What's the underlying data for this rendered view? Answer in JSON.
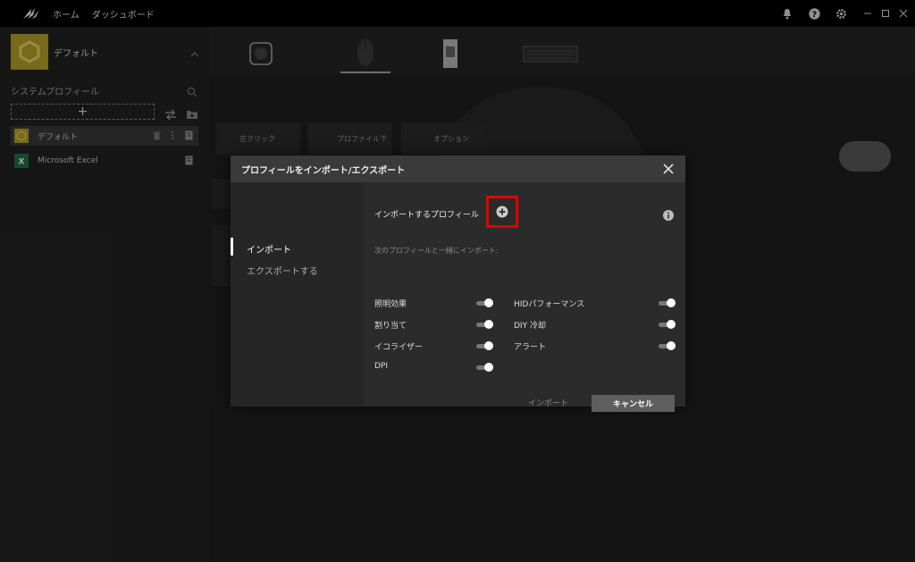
{
  "topbar": {
    "nav": [
      "ホーム",
      "ダッシュボード"
    ]
  },
  "sidebar": {
    "current_profile": "デフォルト",
    "section_label": "システムプロフィール",
    "add_symbol": "+",
    "profiles": [
      {
        "label": "デフォルト",
        "selected": true
      },
      {
        "label": "Microsoft Excel",
        "selected": false
      }
    ]
  },
  "main": {
    "ghost_buttons": [
      "左クリック",
      "プロファイル下",
      "オプション"
    ]
  },
  "dialog": {
    "title": "プロフィールをインポート/エクスポート",
    "tabs": [
      {
        "label": "インポート",
        "active": true
      },
      {
        "label": "エクスポートする",
        "active": false
      }
    ],
    "import_label": "インポートするプロフィール",
    "sub_label": "次のプロフィールと一緒にインポート:",
    "options_left": [
      {
        "label": "照明効果",
        "on": true
      },
      {
        "label": "割り当て",
        "on": true
      },
      {
        "label": "イコライザー",
        "on": true
      },
      {
        "label": "DPI",
        "on": true
      }
    ],
    "options_right": [
      {
        "label": "HIDパフォーマンス",
        "on": true
      },
      {
        "label": "DIY 冷却",
        "on": true
      },
      {
        "label": "アラート",
        "on": true
      }
    ],
    "import_button": "インポート",
    "cancel_button": "キャンセル"
  },
  "colors": {
    "accent_highlight": "#e00000",
    "profile_tile": "#b7a52a"
  }
}
